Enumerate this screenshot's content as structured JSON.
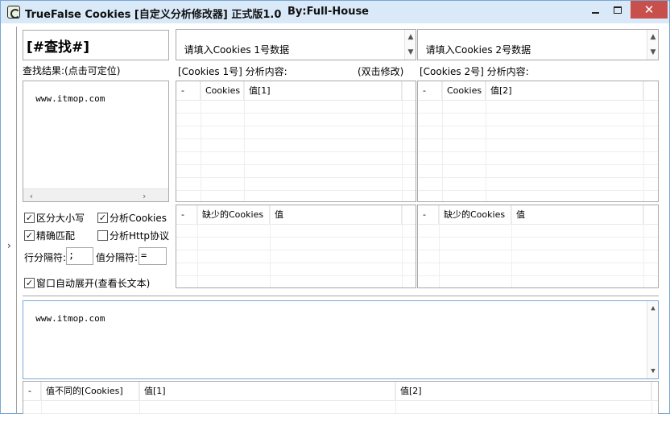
{
  "window": {
    "title": "TrueFalse Cookies [自定义分析修改器] 正式版1.0",
    "author": "By:Full-House",
    "minimize_glyph": "",
    "close_glyph": "✕"
  },
  "search": {
    "title": "[#查找#]",
    "result_label": "查找结果:(点击可定位)",
    "result_text": "www.itmop.com"
  },
  "cookies1": {
    "input_placeholder": "请填入Cookies 1号数据",
    "label": "[Cookies 1号] 分析内容:",
    "hint": "(双击修改)",
    "grid_headers": [
      "-",
      "Cookies",
      "值[1]"
    ],
    "missing_headers": [
      "-",
      "缺少的Cookies",
      "值"
    ]
  },
  "cookies2": {
    "input_placeholder": "请填入Cookies 2号数据",
    "label": "[Cookies 2号] 分析内容:",
    "grid_headers": [
      "-",
      "Cookies",
      "值[2]"
    ],
    "missing_headers": [
      "-",
      "缺少的Cookies",
      "值"
    ]
  },
  "options": {
    "case_sensitive": {
      "label": "区分大小写",
      "checked": true
    },
    "analyze_cookies": {
      "label": "分析Cookies",
      "checked": true
    },
    "exact_match": {
      "label": "精确匹配",
      "checked": true
    },
    "analyze_http": {
      "label": "分析Http协议",
      "checked": false
    },
    "row_sep_label": "行分隔符:",
    "row_sep_value": ";",
    "val_sep_label": "值分隔符:",
    "val_sep_value": "=",
    "auto_expand": {
      "label": "窗口自动展开(查看长文本)",
      "checked": true
    }
  },
  "bottom": {
    "text": "www.itmop.com",
    "diff_headers": [
      "-",
      "值不同的[Cookies]",
      "值[1]",
      "值[2]"
    ]
  },
  "icons": {
    "expander": "›",
    "scroll_up": "▲",
    "scroll_down": "▼",
    "scroll_left": "‹",
    "scroll_right": "›",
    "check": "✓"
  }
}
